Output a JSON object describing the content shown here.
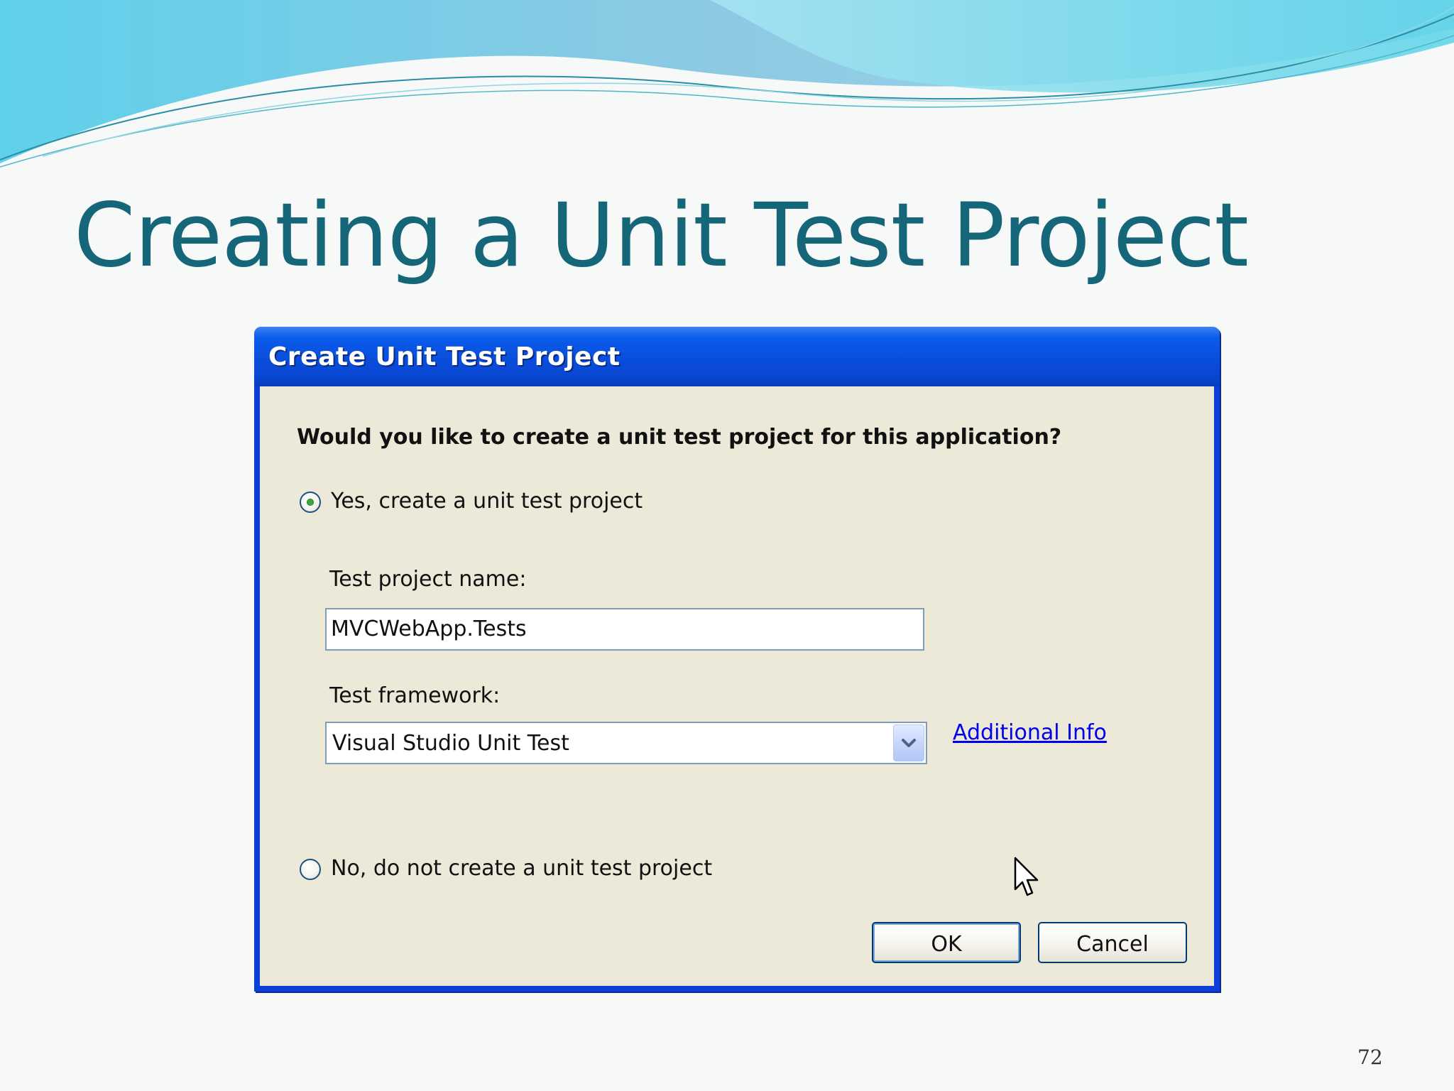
{
  "slide": {
    "title": "Creating a Unit Test Project",
    "page_number": "72"
  },
  "dialog": {
    "title": "Create Unit Test Project",
    "question": "Would you like to create a unit test project for this application?",
    "option_yes": {
      "label": "Yes, create a unit test project",
      "selected": true
    },
    "project_name_label": "Test project name:",
    "project_name_value": "MVCWebApp.Tests",
    "framework_label": "Test framework:",
    "framework_value": "Visual Studio Unit Test",
    "additional_info_link": "Additional Info",
    "option_no": {
      "label": "No, do not create a unit test project",
      "selected": false
    },
    "ok_label": "OK",
    "cancel_label": "Cancel"
  },
  "colors": {
    "title_color": "#16667a",
    "titlebar_blue": "#0a4ddc",
    "dialog_face": "#ece9d8",
    "link_blue": "#0000ee",
    "radio_selected": "#3ea93a"
  },
  "icons": [
    "radio-selected-icon",
    "radio-empty-icon",
    "chevron-down-icon",
    "mouse-pointer-icon"
  ]
}
